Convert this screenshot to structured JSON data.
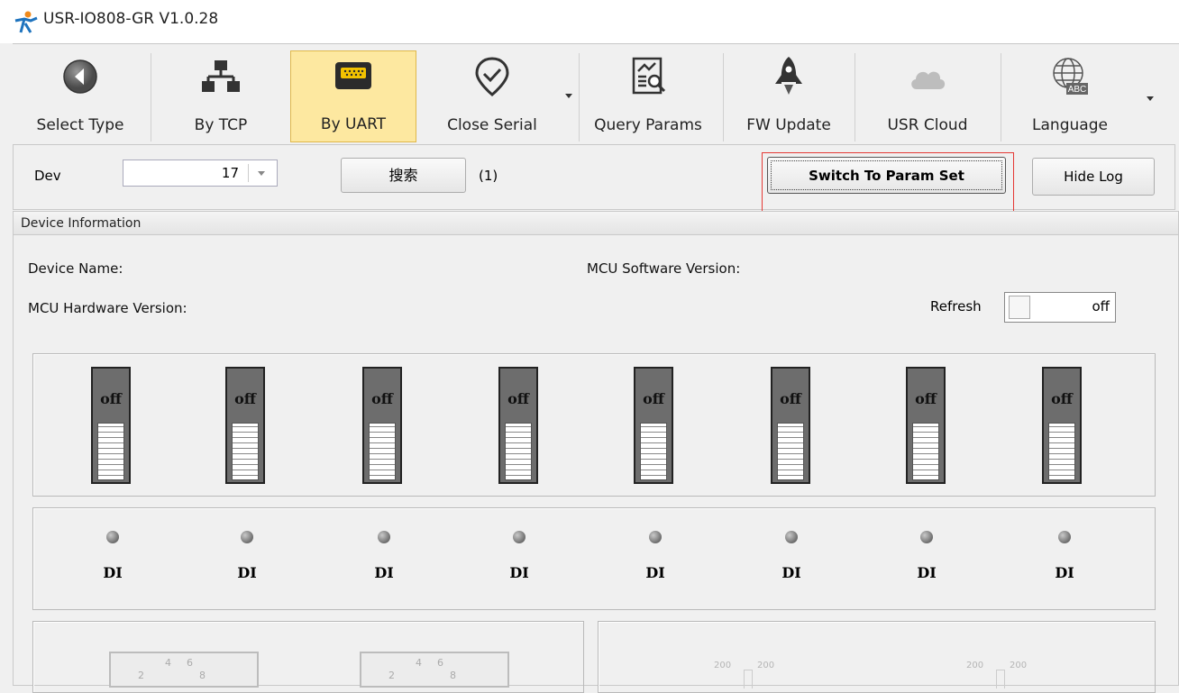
{
  "window": {
    "title": "USR-IO808-GR V1.0.28"
  },
  "toolbar": {
    "items": [
      {
        "label": "Select Type",
        "icon": "back-arrow-icon"
      },
      {
        "label": "By TCP",
        "icon": "network-icon"
      },
      {
        "label": "By UART",
        "icon": "serial-port-icon",
        "active": true
      },
      {
        "label": "Close Serial",
        "icon": "check-circle-icon"
      },
      {
        "label": "Query Params",
        "icon": "query-params-icon"
      },
      {
        "label": "FW Update",
        "icon": "rocket-icon"
      },
      {
        "label": "USR Cloud",
        "icon": "cloud-icon"
      },
      {
        "label": "Language",
        "icon": "globe-abc-icon"
      }
    ]
  },
  "cmdbar": {
    "dev_label": "Dev",
    "dev_value": "17",
    "search_label": "搜索",
    "count": "(1)",
    "switch_label": "Switch To Param Set",
    "hide_log_label": "Hide Log"
  },
  "device_info": {
    "title": "Device Information",
    "device_name_label": "Device Name:",
    "mcu_software_label": "MCU Software Version:",
    "mcu_hardware_label": "MCU Hardware Version:",
    "refresh_label": "Refresh",
    "refresh_state": "off"
  },
  "relays": [
    "off",
    "off",
    "off",
    "off",
    "off",
    "off",
    "off",
    "off"
  ],
  "digital_inputs": [
    "DI",
    "DI",
    "DI",
    "DI",
    "DI",
    "DI",
    "DI",
    "DI"
  ],
  "gauges": {
    "dial_labels": [
      "4",
      "6",
      "2",
      "8"
    ],
    "scale_label": "200"
  },
  "colors": {
    "active_button": "#fde8a0",
    "highlight_box": "#e53935",
    "relay_body": "#6d6d6d"
  }
}
